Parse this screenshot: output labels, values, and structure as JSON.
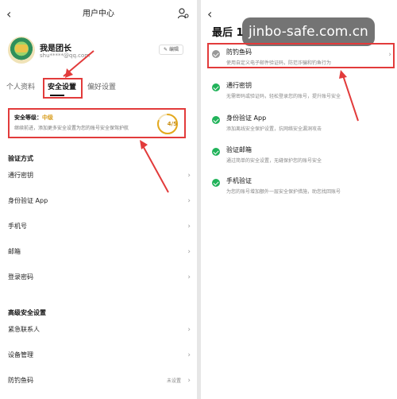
{
  "left": {
    "title": "用户中心",
    "back_icon": "chevron-left-icon",
    "user": {
      "name": "我是团长",
      "email": "shu*****@qq.com",
      "edit": "编辑"
    },
    "tabs": [
      "个人资料",
      "安全设置",
      "偏好设置"
    ],
    "security": {
      "level_label": "安全等级：",
      "level_value": "中级",
      "desc": "继续前进，添加更多安全设置为您的账号安全保驾护航",
      "score": "4/5",
      "score_fraction": 0.8
    },
    "verify_head": "验证方式",
    "verify_items": [
      "通行密钥",
      "身份验证 App",
      "手机号",
      "邮箱",
      "登录密码"
    ],
    "adv_head": "高级安全设置",
    "adv_items": [
      {
        "label": "紧急联系人",
        "value": ""
      },
      {
        "label": "设备管理",
        "value": ""
      },
      {
        "label": "防钓鱼码",
        "value": "未设置"
      }
    ]
  },
  "right": {
    "title": "最后 1",
    "watermark": "jinbo-safe.com.cn",
    "options": [
      {
        "name": "防钓鱼码",
        "desc": "使用自定义电子邮件验证码，防范诈骗和钓鱼行为",
        "status": "pending"
      },
      {
        "name": "通行密钥",
        "desc": "无需密码或验证码，轻松登录您的账号，提升账号安全",
        "status": "done"
      },
      {
        "name": "身份验证 App",
        "desc": "添加离线安全保护设置，抗网络安全漏洞攻击",
        "status": "done"
      },
      {
        "name": "验证邮箱",
        "desc": "通过简单的安全设置，无缝保护您的账号安全",
        "status": "done"
      },
      {
        "name": "手机验证",
        "desc": "为您的账号增加额外一层安全保护措施，助您找回账号",
        "status": "done"
      }
    ]
  },
  "colors": {
    "highlight": "#e23b3b",
    "success": "#21b35a",
    "warning": "#d79a16"
  }
}
